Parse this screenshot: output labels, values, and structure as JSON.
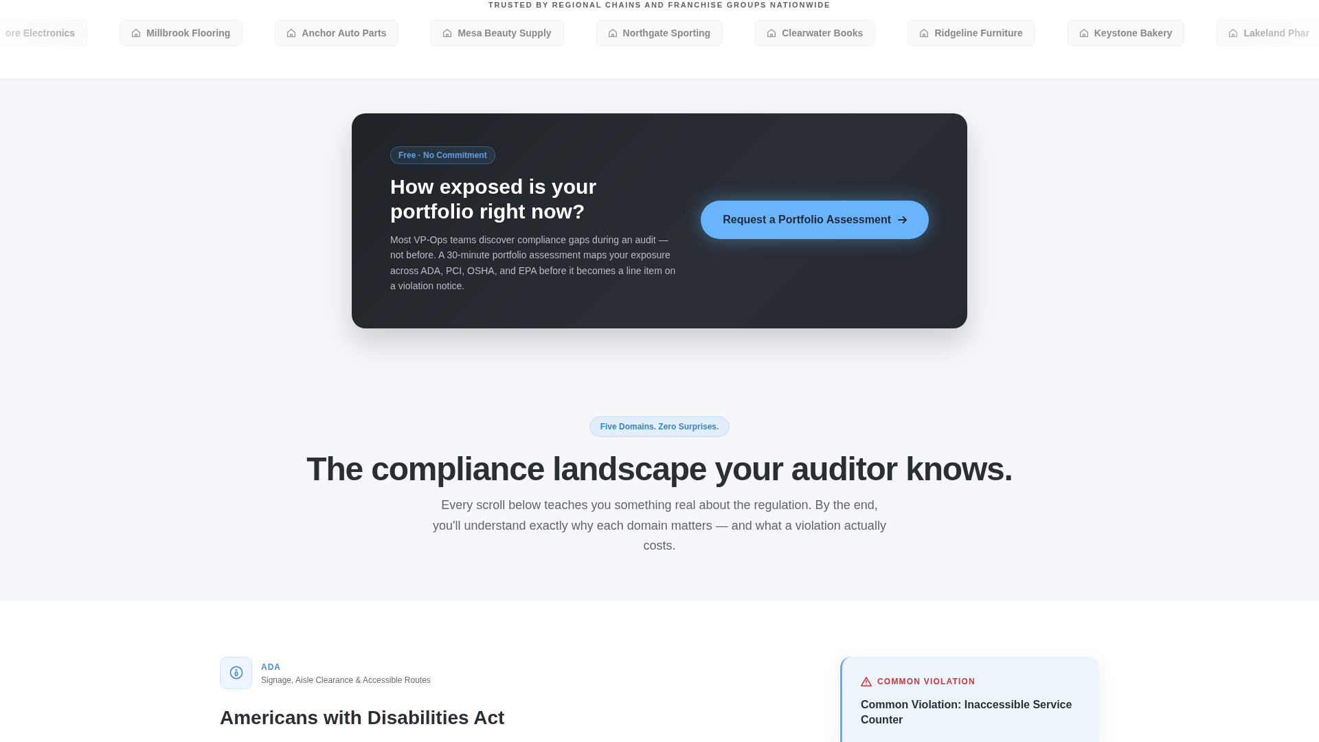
{
  "trust_strip": {
    "heading": "TRUSTED BY REGIONAL CHAINS AND FRANCHISE GROUPS NATIONWIDE",
    "logos": [
      {
        "name": "ore Electronics",
        "clipped": true
      },
      {
        "name": "Millbrook Flooring",
        "clipped": false
      },
      {
        "name": "Anchor Auto Parts",
        "clipped": false
      },
      {
        "name": "Mesa Beauty Supply",
        "clipped": false
      },
      {
        "name": "Northgate Sporting",
        "clipped": false
      },
      {
        "name": "Clearwater Books",
        "clipped": false
      },
      {
        "name": "Ridgeline Furniture",
        "clipped": false
      },
      {
        "name": "Keystone Bakery",
        "clipped": false
      },
      {
        "name": "Lakeland Phar",
        "clipped": true
      }
    ]
  },
  "cta": {
    "badge": "Free · No Commitment",
    "title": "How exposed is your portfolio right now?",
    "body": "Most VP-Ops teams discover compliance gaps during an audit — not before. A 30-minute portfolio assessment maps your exposure across ADA, PCI, OSHA, and EPA before it becomes a line item on a violation notice.",
    "button": "Request a Portfolio Assessment"
  },
  "intro": {
    "badge": "Five Domains. Zero Surprises.",
    "title": "The compliance landscape your auditor knows.",
    "body": "Every scroll below teaches you something real about the regulation. By the end, you'll understand exactly why each domain matters — and what a violation actually costs."
  },
  "domain": {
    "code": "ADA",
    "subtitle": "Signage, Aisle Clearance & Accessible Routes",
    "title": "Americans with Disabilities Act",
    "callout": {
      "label": "COMMON VIOLATION",
      "title": "Common Violation: Inaccessible Service Counter"
    }
  }
}
